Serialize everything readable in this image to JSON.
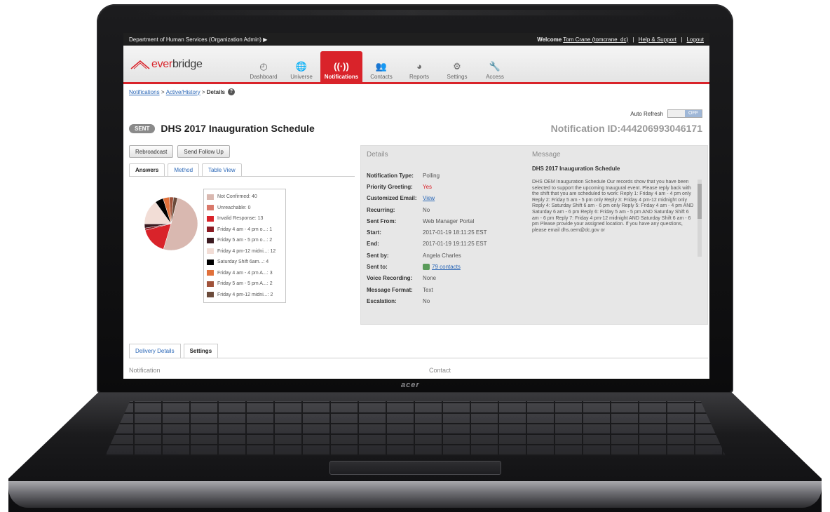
{
  "device": {
    "brand": "acer"
  },
  "topbar": {
    "org": "Department of Human Services (Organization Admin)",
    "org_arrow": "▶",
    "welcome": "Welcome",
    "user": "Tom Crane (tomcrane_dc)",
    "help": "Help & Support",
    "logout": "Logout"
  },
  "logo": {
    "prefix": "ever",
    "suffix": "bridge"
  },
  "nav": [
    {
      "label": "Dashboard",
      "icon": "◴"
    },
    {
      "label": "Universe",
      "icon": "🌐"
    },
    {
      "label": "Notifications",
      "icon": "((·))",
      "active": true
    },
    {
      "label": "Contacts",
      "icon": "👥"
    },
    {
      "label": "Reports",
      "icon": "◕"
    },
    {
      "label": "Settings",
      "icon": "⚙"
    },
    {
      "label": "Access",
      "icon": "🔧"
    }
  ],
  "breadcrumb": {
    "link1": "Notifications",
    "sep": ">",
    "link2": "Active/History",
    "current": "Details",
    "help": "?"
  },
  "autorefresh": {
    "label": "Auto Refresh",
    "state": "OFF"
  },
  "header": {
    "status": "SENT",
    "title": "DHS 2017 Inauguration Schedule",
    "notification_id": "Notification ID:444206993046171"
  },
  "actions": {
    "rebroadcast": "Rebroadcast",
    "follow_up": "Send Follow Up"
  },
  "tabs": [
    "Answers",
    "Method",
    "Table View"
  ],
  "legend": [
    {
      "label": "Not Confirmed: 40",
      "color": "#d9b8b0"
    },
    {
      "label": "Unreachable: 0",
      "color": "#d9786a"
    },
    {
      "label": "Invalid Response: 13",
      "color": "#d9232a"
    },
    {
      "label": "Friday 4 am - 4 pm o...: 1",
      "color": "#8b1a22"
    },
    {
      "label": "Friday 5 am - 5 pm o...: 2",
      "color": "#3b1a20"
    },
    {
      "label": "Friday 4 pm-12 midni...: 12",
      "color": "#f2ddd6"
    },
    {
      "label": "Saturday Shift 6am...: 4",
      "color": "#000000"
    },
    {
      "label": "Friday 4 am - 4 pm A...: 3",
      "color": "#e0703a"
    },
    {
      "label": "Friday 5 am - 5 pm A...: 2",
      "color": "#a0523a"
    },
    {
      "label": "Friday 4 pm-12 midni...: 2",
      "color": "#6b4a3a"
    }
  ],
  "details": {
    "heading": "Details",
    "rows": [
      {
        "k": "Notification Type:",
        "v": "Polling"
      },
      {
        "k": "Priority Greeting:",
        "v": "Yes"
      },
      {
        "k": "Customized Email:",
        "v": "View"
      },
      {
        "k": "Recurring:",
        "v": "No"
      },
      {
        "k": "Sent From:",
        "v": "Web Manager Portal"
      },
      {
        "k": "Start:",
        "v": "2017-01-19 18:11:25 EST"
      },
      {
        "k": "End:",
        "v": "2017-01-19 19:11:25 EST"
      },
      {
        "k": "Sent by:",
        "v": "Angela Charles"
      },
      {
        "k": "Sent to:",
        "v": "79 contacts"
      },
      {
        "k": "Voice Recording:",
        "v": "None"
      },
      {
        "k": "Message Format:",
        "v": "Text"
      },
      {
        "k": "Escalation:",
        "v": "No"
      }
    ]
  },
  "message": {
    "heading": "Message",
    "title": "DHS 2017 Inauguration Schedule",
    "body": "DHS OEM Inauguration Schedule Our records show that you have been selected to support the upcoming Inaugural event. Please reply back with the shift that you are scheduled to work: Reply 1: Friday 4 am - 4 pm only Reply 2: Friday 5 am - 5 pm only Reply 3: Friday 4 pm-12 midnight only Reply 4: Saturday Shift 6 am - 6 pm only Reply 5: Friday 4 am - 4 pm AND Saturday 6 am - 6 pm Reply 6: Friday 5 am - 5 pm AND Saturday Shift 6 am - 6 pm Reply 7: Friday 4 pm-12 midnight AND Saturday Shift 6 am - 6 pm Please provide your assigned location. If you have any questions, please email dhs.oem@dc.gov or"
  },
  "bottom_tabs": [
    "Delivery Details",
    "Settings"
  ],
  "bottom_sections": {
    "left": "Notification",
    "right": "Contact"
  },
  "chart_data": {
    "type": "pie",
    "title": "",
    "labels": [
      "Not Confirmed",
      "Unreachable",
      "Invalid Response",
      "Friday 4 am - 4 pm o...",
      "Friday 5 am - 5 pm o...",
      "Friday 4 pm-12 midni...",
      "Saturday Shift 6am...",
      "Friday 4 am - 4 pm A...",
      "Friday 5 am - 5 pm A...",
      "Friday 4 pm-12 midni..."
    ],
    "values": [
      40,
      0,
      13,
      1,
      2,
      12,
      4,
      3,
      2,
      2
    ],
    "colors": [
      "#d9b8b0",
      "#d9786a",
      "#d9232a",
      "#8b1a22",
      "#3b1a20",
      "#f2ddd6",
      "#000000",
      "#e0703a",
      "#a0523a",
      "#6b4a3a"
    ]
  }
}
